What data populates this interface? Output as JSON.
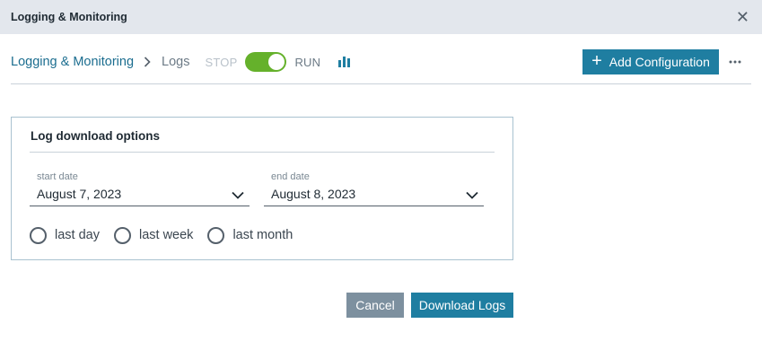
{
  "window": {
    "title": "Logging & Monitoring",
    "close_icon": "close-icon"
  },
  "toolbar": {
    "breadcrumb_root": "Logging & Monitoring",
    "breadcrumb_current": "Logs",
    "stop_label": "STOP",
    "run_label": "RUN",
    "toggle_state": "on",
    "toggle_color": "#65b12b",
    "chart_icon": "bar-chart-icon",
    "add_configuration_label": "Add Configuration",
    "more_icon": "more-horizontal-icon",
    "accent_color": "#1f7ea1"
  },
  "panel": {
    "title": "Log download options",
    "start_date": {
      "label": "start date",
      "value": "August 7, 2023"
    },
    "end_date": {
      "label": "end date",
      "value": "August 8, 2023"
    },
    "radio_options": [
      {
        "label": "last day",
        "selected": false
      },
      {
        "label": "last week",
        "selected": false
      },
      {
        "label": "last month",
        "selected": false
      }
    ]
  },
  "actions": {
    "cancel_label": "Cancel",
    "download_label": "Download Logs"
  }
}
